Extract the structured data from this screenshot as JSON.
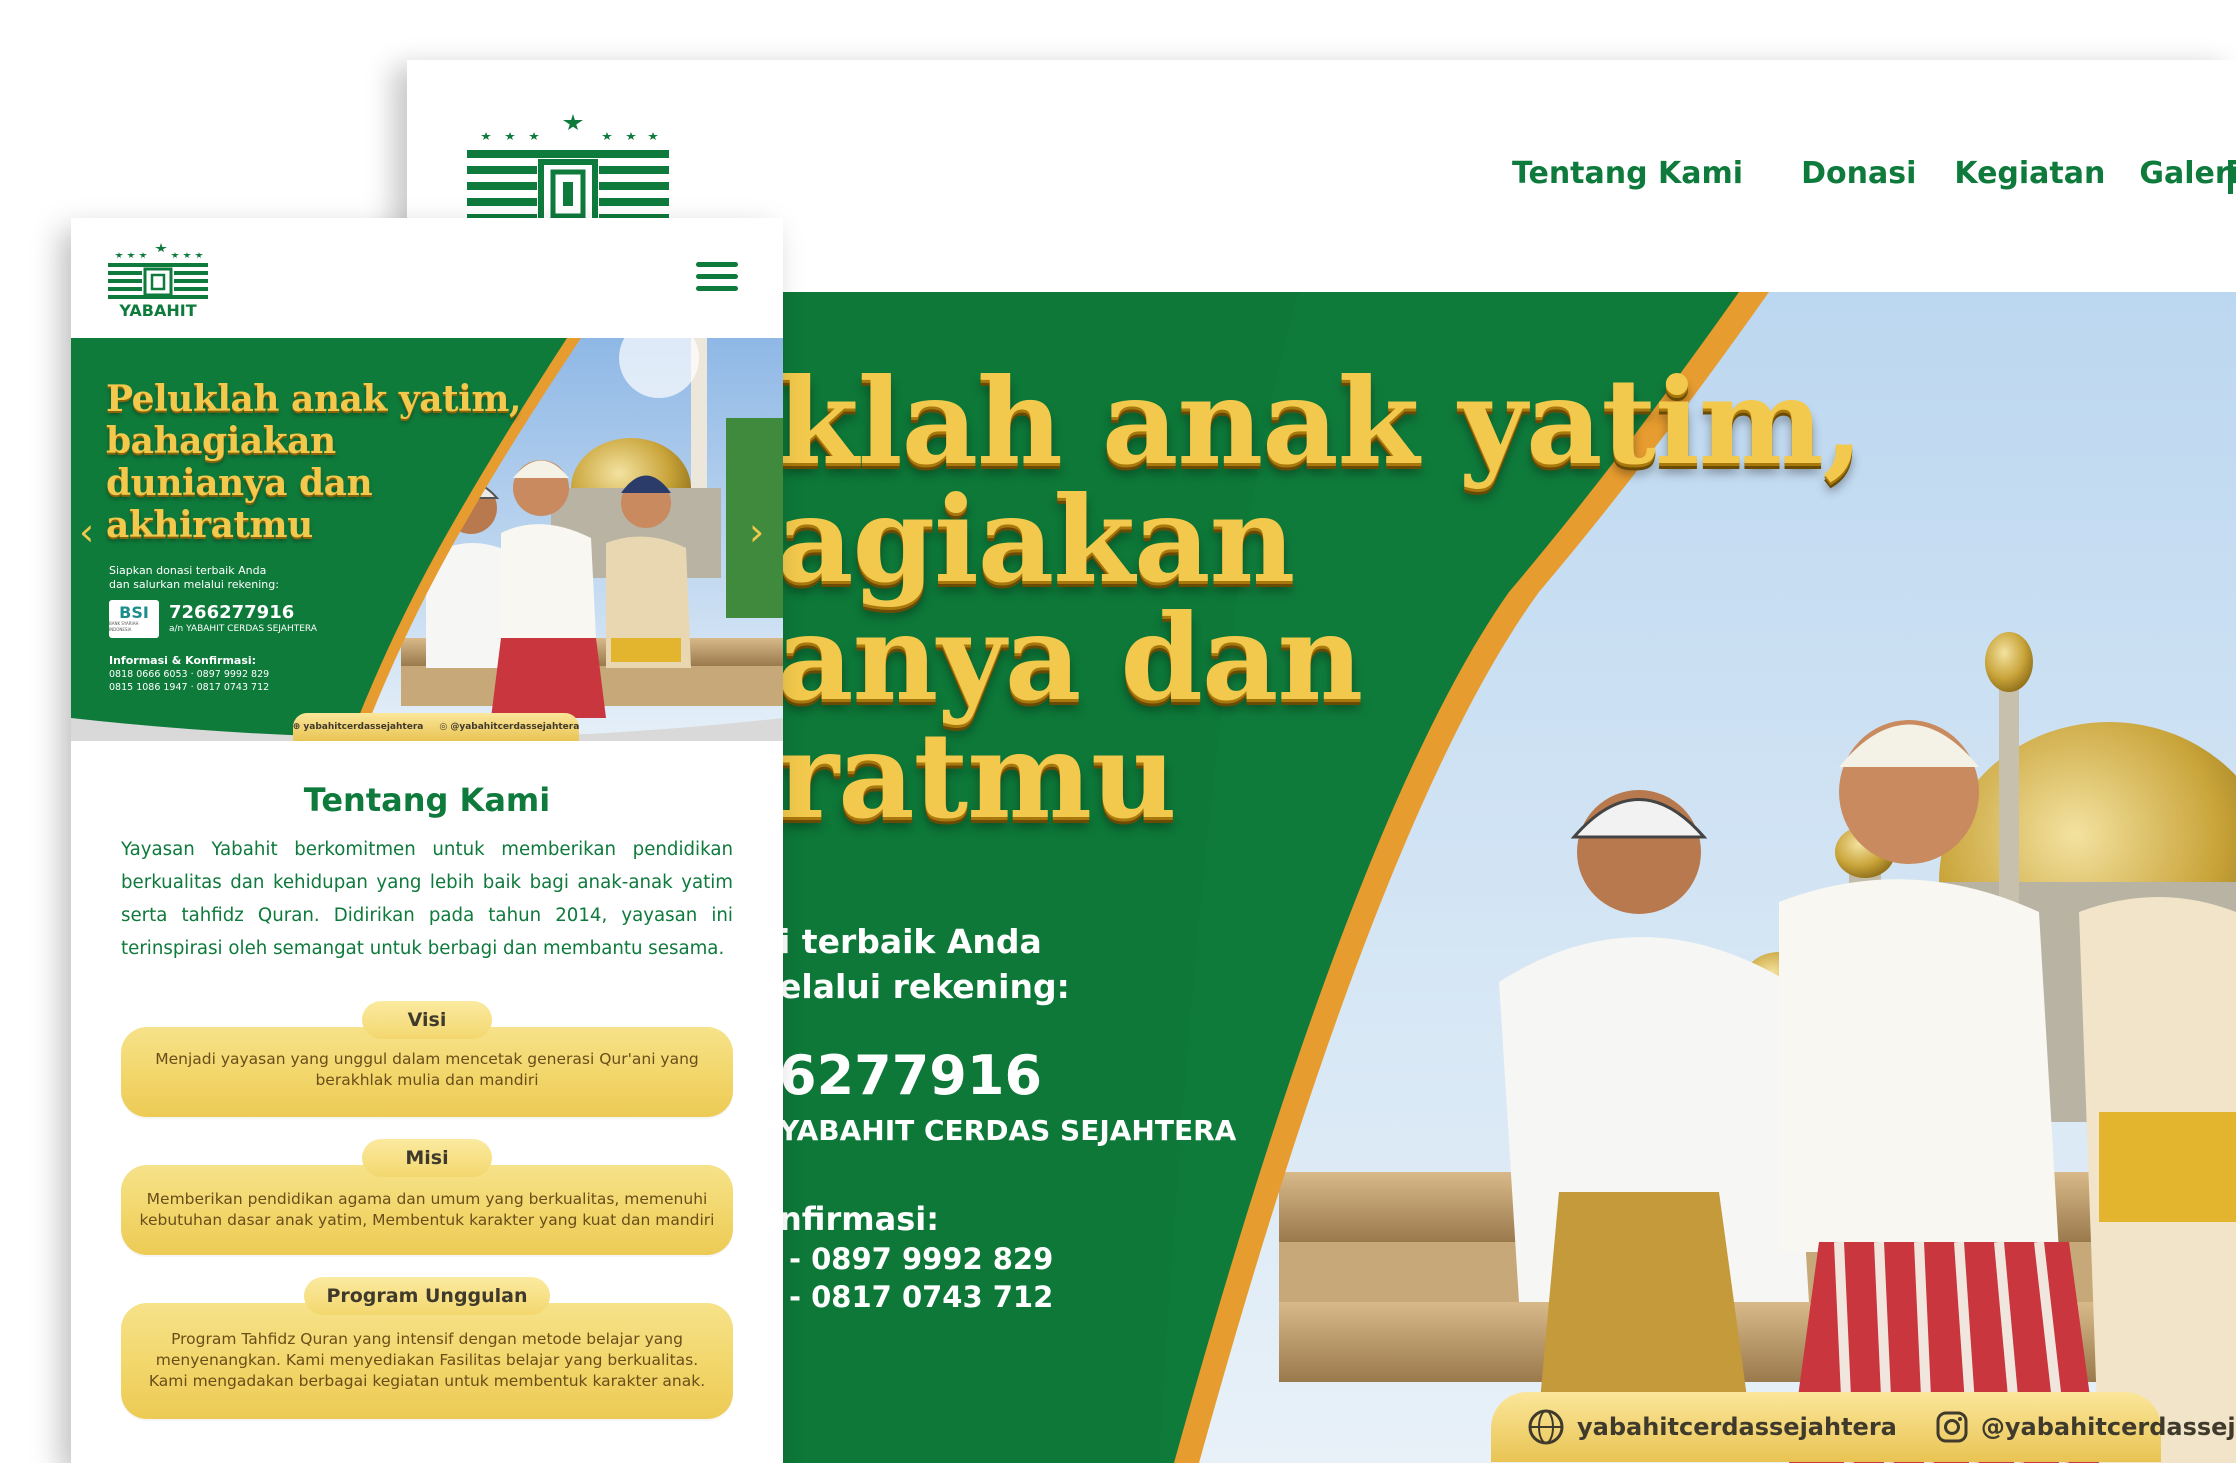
{
  "colors": {
    "brand_green": "#0e7a3c",
    "gold": "#f2c94c",
    "card_gold": "#f2d66a"
  },
  "desktop": {
    "logo_alt": "Yabahit logo",
    "nav": [
      {
        "label": "Tentang Kami"
      },
      {
        "label": "Donasi"
      },
      {
        "label": "Kegiatan"
      },
      {
        "label": "Galeri"
      }
    ],
    "banner": {
      "headline_lines": [
        "klah anak yatim,",
        "agiakan",
        "anya dan",
        "ratmu"
      ],
      "info_lines": [
        "i terbaik Anda",
        "elalui rekening:"
      ],
      "account_number": "6277916",
      "account_name": "YABAHIT CERDAS SEJAHTERA",
      "confirm_label": "nfirmasi:",
      "phone_1": "- 0897 9992 829",
      "phone_2": "- 0817 0743 712",
      "website": "yabahitcerdassejahtera",
      "instagram": "@yabahitcerdassejahtera"
    }
  },
  "mobile": {
    "logo_text": "YABAHIT",
    "menu_icon": "hamburger-icon",
    "banner": {
      "headline_lines": [
        "Peluklah anak yatim,",
        "bahagiakan",
        "dunianya dan",
        "akhiratmu"
      ],
      "info_1": "Siapkan donasi terbaik Anda",
      "info_2": "dan salurkan melalui rekening:",
      "bank": "BSI",
      "bank_sub": "BANK SYARIAH INDONESIA",
      "account_number": "7266277916",
      "account_name": "a/n YABAHIT CERDAS SEJAHTERA",
      "confirm_label": "Informasi & Konfirmasi:",
      "phones_1": "0818 0666 6053  · 0897 9992 829",
      "phones_2": "0815 1086 1947  · 0817 0743 712",
      "website": "yabahitcerdassejahtera",
      "instagram": "@yabahitcerdassejahtera"
    },
    "about": {
      "title": "Tentang Kami",
      "lines": [
        "Yayasan Yabahit berkomitmen untuk memberikan pendidikan",
        "berkualitas dan kehidupan yang lebih baik bagi anak-anak yatim",
        "serta tahfidz Quran. Didirikan pada tahun 2014, yayasan ini",
        "terinspirasi oleh semangat untuk berbagi dan membantu sesama."
      ]
    },
    "cards": [
      {
        "title": "Visi",
        "lines": [
          "Menjadi yayasan yang unggul dalam mencetak generasi Qur'ani yang",
          "berakhlak mulia dan mandiri"
        ]
      },
      {
        "title": "Misi",
        "lines": [
          "Memberikan pendidikan agama dan umum yang berkualitas, memenuhi",
          "kebutuhan dasar anak yatim, Membentuk karakter yang kuat dan mandiri"
        ]
      },
      {
        "title": "Program Unggulan",
        "lines": [
          "Program Tahfidz Quran yang intensif dengan metode belajar yang",
          "menyenangkan. Kami menyediakan Fasilitas belajar yang berkualitas.",
          "Kami mengadakan berbagai kegiatan untuk membentuk karakter anak."
        ]
      }
    ]
  }
}
